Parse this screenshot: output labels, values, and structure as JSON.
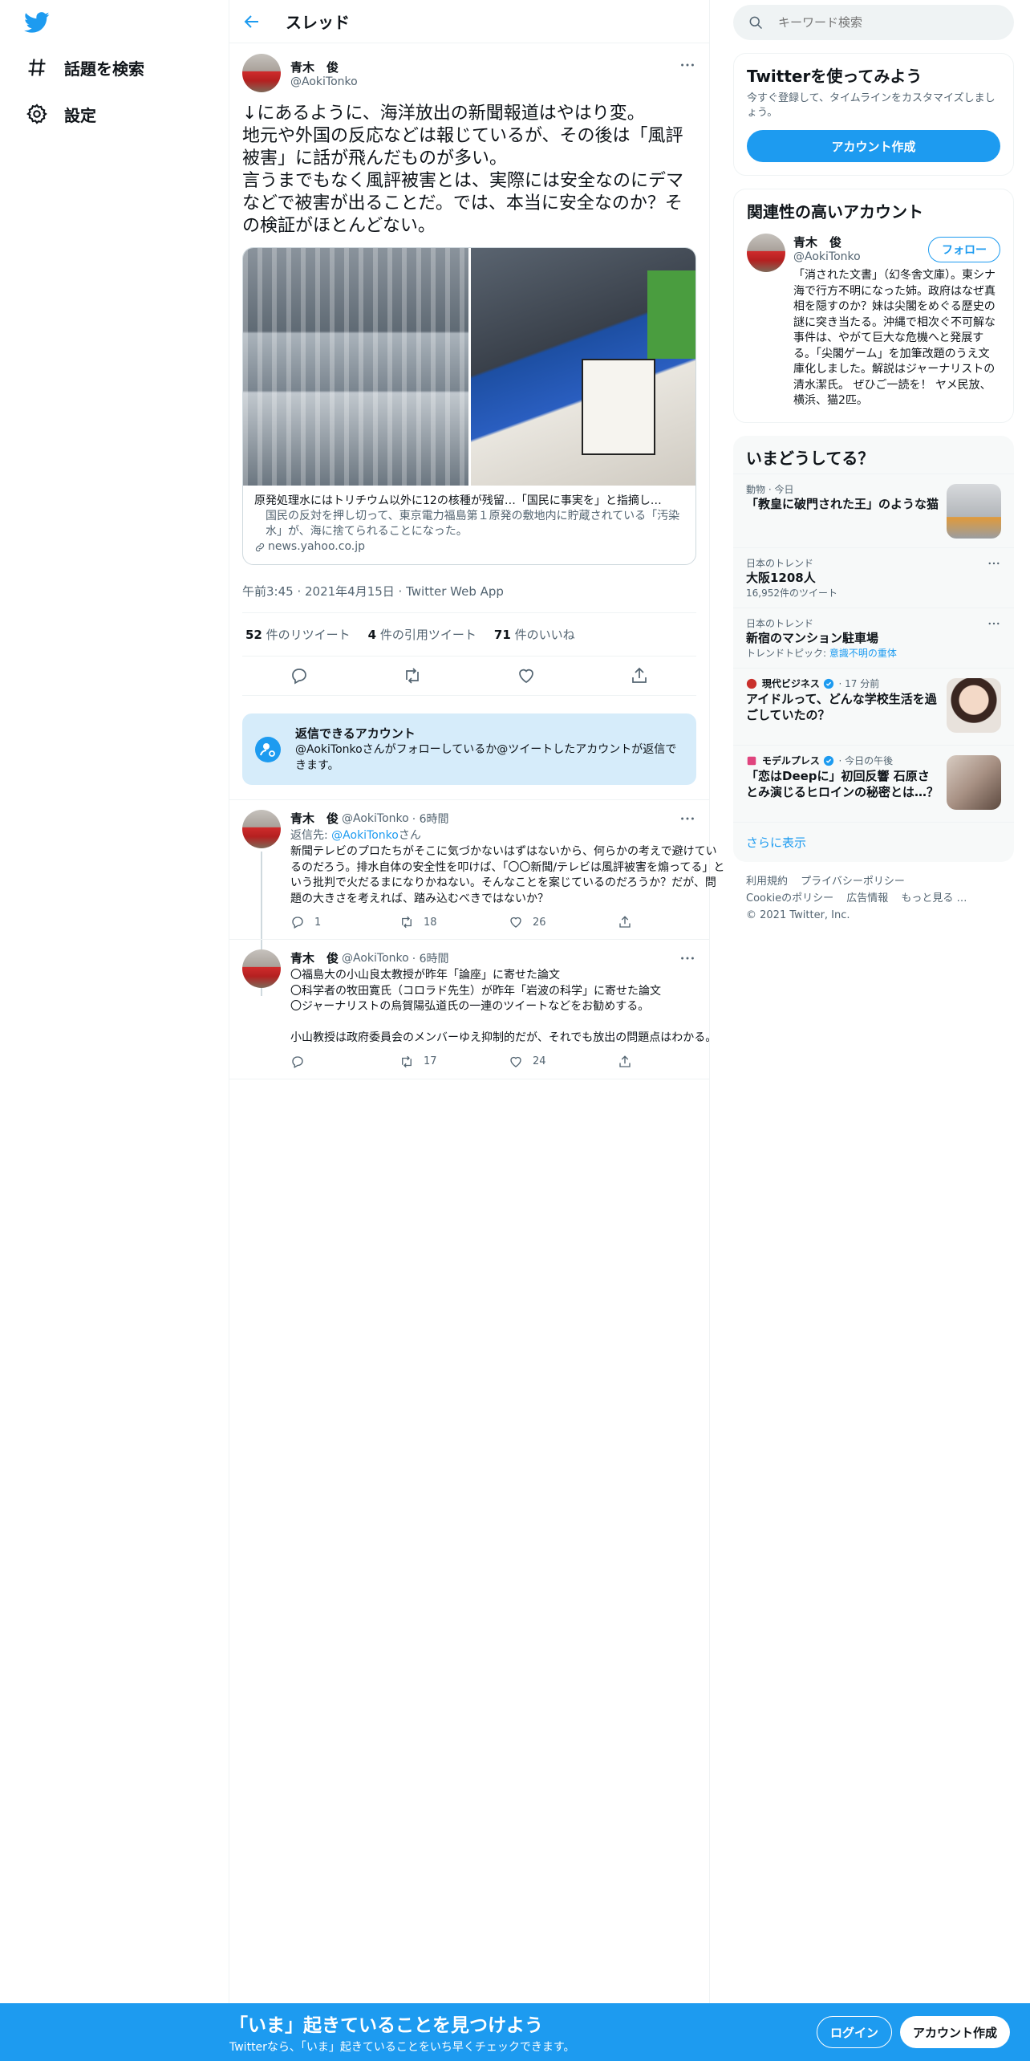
{
  "brand": {
    "logo": "twitter-bird-icon",
    "accent": "#1d9bf0"
  },
  "nav": {
    "explore_label": "話題を検索",
    "settings_label": "設定"
  },
  "header": {
    "title": "スレッド"
  },
  "focus_tweet": {
    "name": "青木　俊",
    "handle": "@AokiTonko",
    "text": "↓にあるように、海洋放出の新聞報道はやはり変。\n地元や外国の反応などは報じているが、その後は「風評被害」に話が飛んだものが多い。\n言うまでもなく風評被害とは、実際には安全なのにデマなどで被害が出ることだ。では、本当に安全なのか？その検証がほとんどない。",
    "card": {
      "title": "原発処理水にはトリチウム以外に12の核種が残留…「国民に事実を」と指摘し…",
      "description": "国民の反対を押し切って、東京電力福島第１原発の敷地内に貯蔵されている「汚染水」が、海に捨てられることになった。",
      "domain": "news.yahoo.co.jp"
    },
    "timestamp": "午前3:45 · 2021年4月15日 · Twitter Web App",
    "retweets": "52",
    "retweets_label": "件のリツイート",
    "quotes": "4",
    "quotes_label": "件の引用ツイート",
    "likes": "71",
    "likes_label": "件のいいね"
  },
  "reply_callout": {
    "title": "返信できるアカウント",
    "text": "@AokiTonkoさんがフォローしているか@ツイートしたアカウントが返信できます。"
  },
  "replies": [
    {
      "name": "青木　俊",
      "handle": "@AokiTonko",
      "time": "· 6時間",
      "reply_to_prefix": "返信先: ",
      "reply_to_handle": "@AokiTonko",
      "reply_to_suffix": "さん",
      "text": "新聞テレビのプロたちがそこに気づかないはずはないから、何らかの考えで避けているのだろう。排水自体の安全性を叩けば、「〇〇新聞/テレビは風評被害を煽ってる」という批判で火だるまになりかねない。そんなことを案じているのだろうか？だが、問題の大きさを考えれば、踏み込むべきではないか？",
      "replies": "1",
      "retweets": "18",
      "likes": "26"
    },
    {
      "name": "青木　俊",
      "handle": "@AokiTonko",
      "time": "· 6時間",
      "text": "〇福島大の小山良太教授が昨年「論座」に寄せた論文\n〇科学者の牧田寛氏（コロラド先生）が昨年「岩波の科学」に寄せた論文\n〇ジャーナリストの烏賀陽弘道氏の一連のツイートなどをお勧めする。\n\n小山教授は政府委員会のメンバーゆえ抑制的だが、それでも放出の問題点はわかる。",
      "replies": "",
      "retweets": "17",
      "likes": "24"
    }
  ],
  "search": {
    "placeholder": "キーワード検索"
  },
  "signup_box": {
    "title": "Twitterを使ってみよう",
    "subtitle": "今すぐ登録して、タイムラインをカスタマイズしましょう。",
    "button": "アカウント作成"
  },
  "relevant": {
    "title": "関連性の高いアカウント",
    "name": "青木　俊",
    "handle": "@AokiTonko",
    "follow": "フォロー",
    "bio": "「消された文書」（幻冬舎文庫）。東シナ海で行方不明になった姉。政府はなぜ真相を隠すのか？妹は尖閣をめぐる歴史の謎に突き当たる。沖縄で相次ぐ不可解な事件は、やがて巨大な危機へと発展する。「尖閣ゲーム」を加筆改題のうえ文庫化しました。解説はジャーナリストの清水潔氏。 ぜひご一読を！ ヤメ民放、横浜、猫2匹。"
  },
  "trends": {
    "title": "いまどうしてる？",
    "items": [
      {
        "context": "動物 · 今日",
        "title": "「教皇に破門された王」のような猫",
        "sub": "",
        "thumb_color": "#b9bcc0"
      },
      {
        "context": "日本のトレンド",
        "title": "大阪1208人",
        "sub": "16,952件のツイート"
      },
      {
        "context": "日本のトレンド",
        "title": "新宿のマンション駐車場",
        "sub_prefix": "トレンドトピック: ",
        "sub_link": "意識不明の重体"
      },
      {
        "context_source": "現代ビジネス",
        "context_time": "· 17 分前",
        "title": "アイドルって、どんな学校生活を過ごしていたの？",
        "thumb_color": "#8a5a4a"
      },
      {
        "context_source": "モデルプレス",
        "context_time": "· 今日の午後",
        "title": "「恋はDeepに」初回反響 石原さとみ演じるヒロインの秘密とは…？",
        "thumb_color": "#c9b7a8"
      }
    ],
    "show_more": "さらに表示"
  },
  "footer": {
    "links": [
      "利用規約",
      "プライバシーポリシー",
      "Cookieのポリシー",
      "広告情報",
      "もっと見る …"
    ],
    "copyright": "© 2021 Twitter, Inc."
  },
  "bottom_bar": {
    "title": "「いま」起きていることを見つけよう",
    "subtitle": "Twitterなら、「いま」起きていることをいち早くチェックできます。",
    "login": "ログイン",
    "signup": "アカウント作成"
  }
}
